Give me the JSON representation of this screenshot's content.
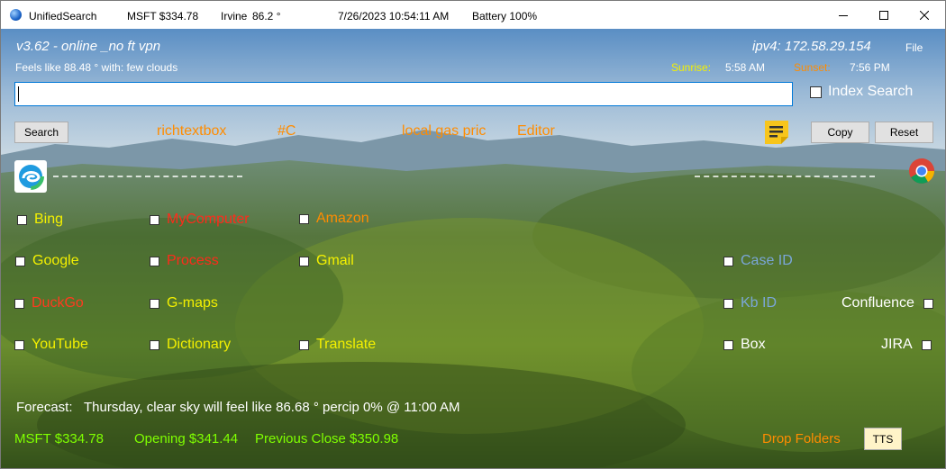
{
  "titlebar": {
    "app_name": "UnifiedSearch",
    "stock": "MSFT $334.78",
    "city": "Irvine",
    "temp": "86.2 °",
    "datetime": "7/26/2023 10:54:11 AM",
    "battery": "Battery 100%"
  },
  "header": {
    "version": "v3.62 - online  _no ft vpn",
    "feels_like": "Feels like 88.48 ° with: few clouds",
    "ipv4": "ipv4: 172.58.29.154",
    "file_menu": "File",
    "sunrise_label": "Sunrise:",
    "sunrise_time": "5:58 AM",
    "sunset_label": "Sunset:",
    "sunset_time": "7:56 PM"
  },
  "search": {
    "value": "",
    "index_search_label": "Index Search",
    "search_button": "Search",
    "copy_button": "Copy",
    "reset_button": "Reset"
  },
  "toolbar_links": {
    "richtextbox": "richtextbox",
    "csharp": "#C",
    "gas": "local gas pric",
    "editor": "Editor"
  },
  "engines": {
    "col1": [
      "Bing",
      "Google",
      "DuckGo",
      "YouTube"
    ],
    "col2": [
      "MyComputer",
      "Process",
      "G-maps",
      "Dictionary"
    ],
    "col3": [
      "Amazon",
      "Gmail",
      "Translate"
    ],
    "col4": [
      "Case ID",
      "Kb ID",
      "Box"
    ],
    "col5": [
      "Confluence",
      "JIRA"
    ]
  },
  "forecast": {
    "label": "Forecast:",
    "text": "Thursday, clear sky will feel like 86.68 ° percip 0% @ 11:00 AM"
  },
  "footer": {
    "stock": "MSFT $334.78",
    "opening": "Opening $341.44",
    "previous_close": "Previous Close $350.98",
    "drop_folders": "Drop Folders",
    "tts_button": "TTS"
  },
  "colors": {
    "yellow": "#f4f000",
    "orange": "#ff8c00",
    "red": "#ff2a1a",
    "steel_blue": "#7aa6d8",
    "white": "#ffffff",
    "accent": "#0078d7"
  },
  "icons": [
    "globe-icon",
    "minimize-icon",
    "maximize-icon",
    "close-icon",
    "edge-icon",
    "chrome-icon",
    "sticky-notes-icon"
  ]
}
